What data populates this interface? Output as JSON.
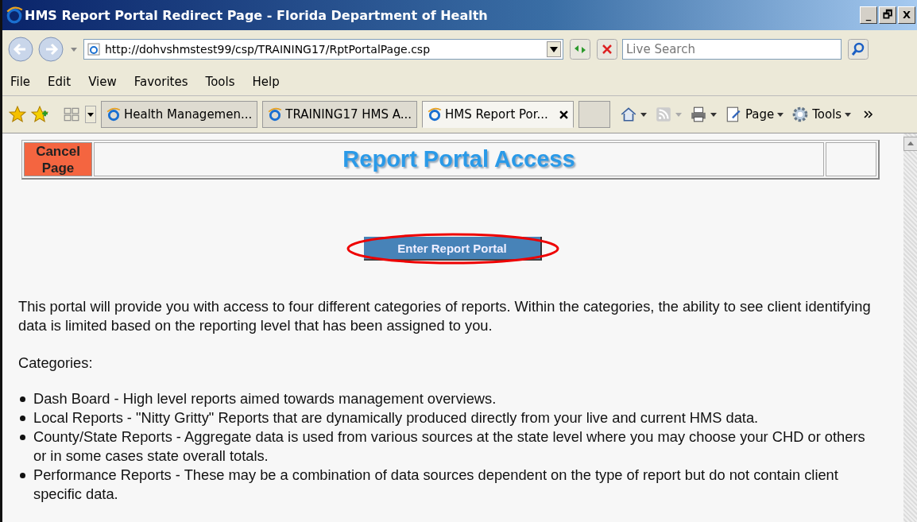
{
  "window": {
    "title": "HMS Report Portal Redirect Page - Florida Department of Health",
    "controls": [
      "_",
      "🗗",
      "X"
    ]
  },
  "address_bar": {
    "url": "http://dohvshmstest99/csp/TRAINING17/RptPortalPage.csp",
    "search_placeholder": "Live Search"
  },
  "menu": [
    "File",
    "Edit",
    "View",
    "Favorites",
    "Tools",
    "Help"
  ],
  "tabs": [
    {
      "label": "Health Managemen...",
      "selected": false
    },
    {
      "label": "TRAINING17 HMS A...",
      "selected": false
    },
    {
      "label": "HMS Report Por...",
      "selected": true
    }
  ],
  "command_bar": [
    "Page",
    "Tools"
  ],
  "page": {
    "cancel_button": "Cancel Page",
    "heading": "Report Portal Access",
    "enter_button": "Enter Report Portal",
    "enter_highlighted": true,
    "intro": "This portal will provide you with access to four different categories of reports. Within the categories, the ability to see client identifying data is limited based on the reporting level that has been assigned to you.",
    "categories_label": "Categories:",
    "categories": [
      "Dash Board - High level reports aimed towards management overviews.",
      "Local Reports - \"Nitty Gritty\" Reports that are dynamically produced directly from your live and current HMS data.",
      "County/State Reports - Aggregate data is used from various sources at the state level where you may choose your CHD or others or in some cases state overall totals.",
      "Performance Reports - These may be a combination of data sources dependent on the type of report but do not contain client specific data."
    ]
  }
}
